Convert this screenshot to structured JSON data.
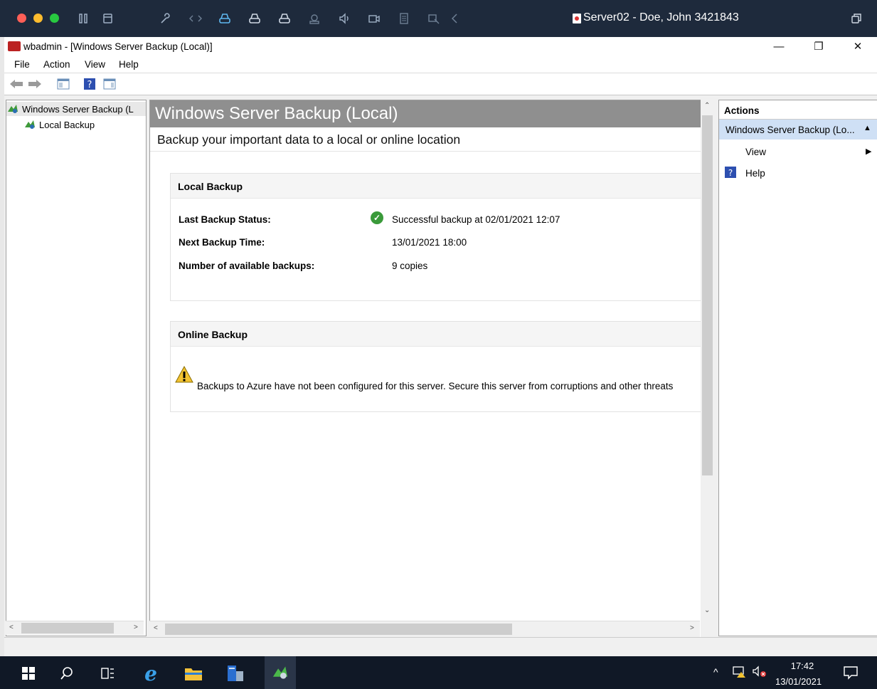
{
  "host": {
    "title": "Server02 - Doe, John 3421843",
    "traffic_colors": [
      "#ff5f57",
      "#febc2e",
      "#28c840"
    ],
    "icons": [
      "pause-icon",
      "window-icon",
      "wrench-icon",
      "code-arrows-icon",
      "drive-icon",
      "drive-icon",
      "drive-icon",
      "camera-icon",
      "speaker-icon",
      "video-icon",
      "document-icon",
      "devices-icon",
      "back-chevron-icon"
    ],
    "right_icon": "restore-window-icon"
  },
  "window": {
    "title": "wbadmin - [Windows Server Backup (Local)]",
    "controls": [
      "—",
      "❐",
      "✕"
    ]
  },
  "menu": [
    "File",
    "Action",
    "View",
    "Help"
  ],
  "tree": {
    "root": "Windows Server Backup (L",
    "child": "Local Backup"
  },
  "main": {
    "title": "Windows Server Backup (Local)",
    "subtitle": "Backup your important data to a local or online location",
    "local": {
      "title": "Local Backup",
      "rows": [
        {
          "label": "Last Backup Status:",
          "value": "Successful backup at 02/01/2021 12:07"
        },
        {
          "label": "Next Backup Time:",
          "value": "13/01/2021 18:00"
        },
        {
          "label": "Number of available backups:",
          "value": "9 copies"
        }
      ]
    },
    "online": {
      "title": "Online Backup",
      "message": "Backups to Azure have not been configured for this server. Secure this server from corruptions and other threats"
    }
  },
  "actions": {
    "title": "Actions",
    "group": "Windows Server Backup (Lo...",
    "items": [
      "View",
      "Help"
    ]
  },
  "taskbar": {
    "time": "17:42",
    "date": "13/01/2021",
    "accent": "#101826"
  }
}
